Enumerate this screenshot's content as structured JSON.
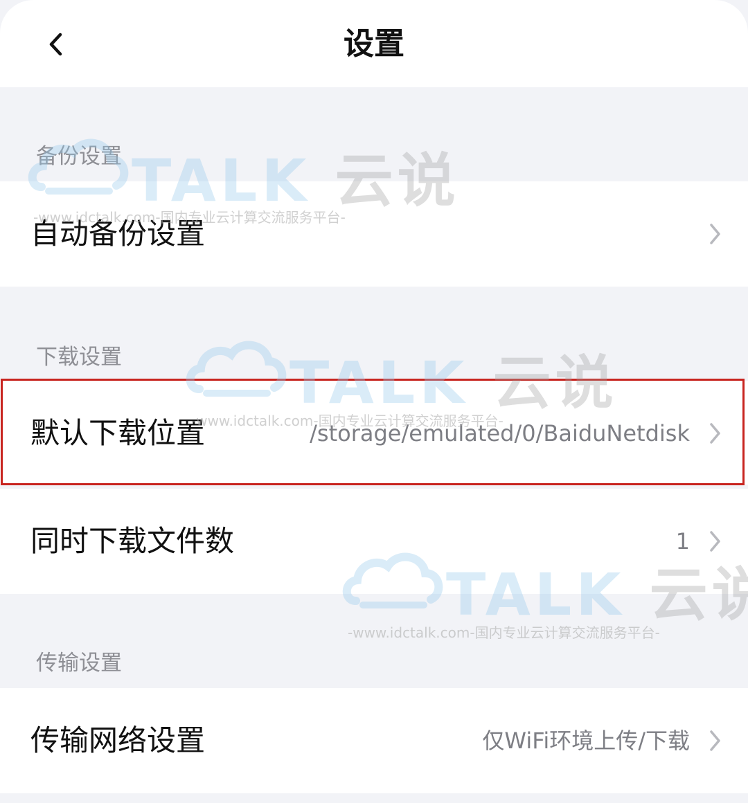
{
  "header": {
    "title": "设置"
  },
  "sections": {
    "backup": {
      "label": "备份设置",
      "items": [
        {
          "label": "自动备份设置",
          "value": ""
        }
      ]
    },
    "download": {
      "label": "下载设置",
      "items": [
        {
          "label": "默认下载位置",
          "value": "/storage/emulated/0/BaiduNetdisk"
        },
        {
          "label": "同时下载文件数",
          "value": "1"
        }
      ]
    },
    "transfer": {
      "label": "传输设置",
      "items": [
        {
          "label": "传输网络设置",
          "value": "仅WiFi环境上传/下载"
        }
      ]
    }
  },
  "watermark": {
    "brand_main": "TALK",
    "brand_cn": "云说",
    "url": "-www.idctalk.com-国内专业云计算交流服务平台-"
  },
  "colors": {
    "background": "#f2f3f7",
    "card": "#ffffff",
    "highlight_border": "#c8241f",
    "secondary_text": "#8e8f95"
  }
}
